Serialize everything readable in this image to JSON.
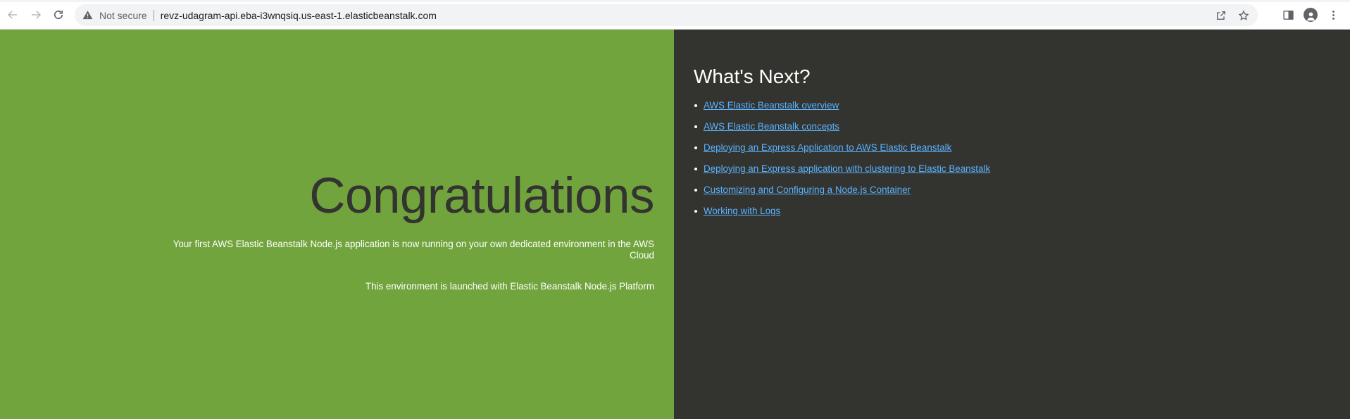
{
  "browser": {
    "security_label": "Not secure",
    "url": "revz-udagram-api.eba-i3wnqsiq.us-east-1.elasticbeanstalk.com",
    "icons": {
      "back": "back-arrow-icon",
      "forward": "forward-arrow-icon",
      "reload": "reload-icon",
      "warning": "warning-icon",
      "share": "share-icon",
      "bookmark": "star-icon",
      "side_panel": "side-panel-icon",
      "profile": "profile-avatar-icon",
      "menu": "kebab-menu-icon"
    }
  },
  "left": {
    "heading": "Congratulations",
    "paragraph1": "Your first AWS Elastic Beanstalk Node.js application is now running on your own dedicated environment in the AWS Cloud",
    "paragraph2": "This environment is launched with Elastic Beanstalk Node.js Platform"
  },
  "right": {
    "heading": "What's Next?",
    "links": [
      "AWS Elastic Beanstalk overview",
      "AWS Elastic Beanstalk concepts",
      "Deploying an Express Application to AWS Elastic Beanstalk",
      "Deploying an Express application with clustering to Elastic Beanstalk",
      "Customizing and Configuring a Node.js Container",
      "Working with Logs"
    ]
  },
  "colors": {
    "left_bg": "#72a43e",
    "right_bg": "#33332f",
    "link": "#5ab3ff"
  }
}
